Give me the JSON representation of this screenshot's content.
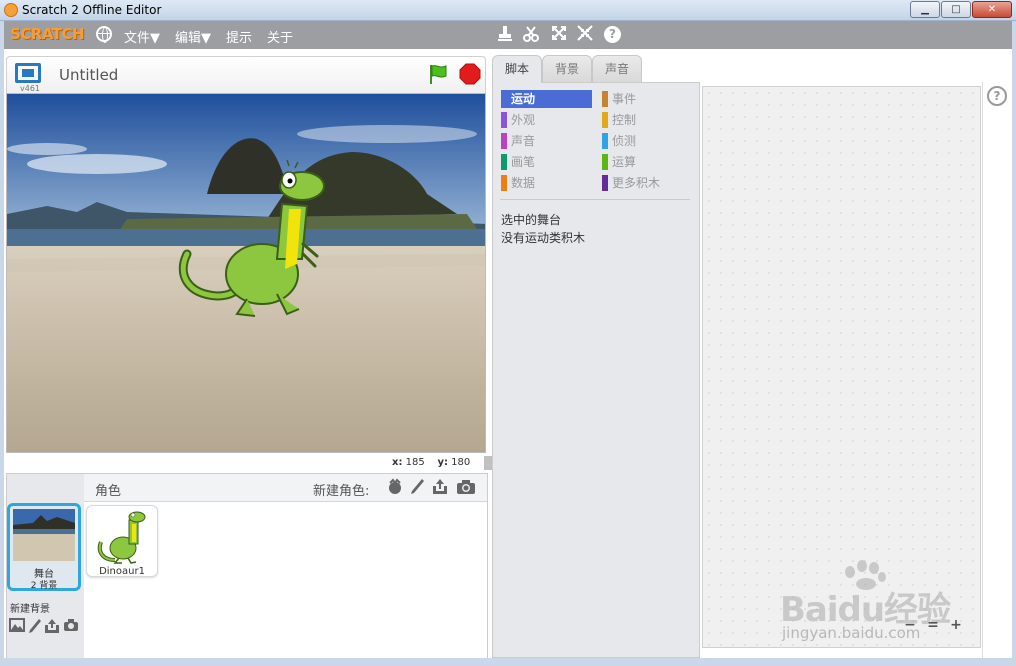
{
  "window": {
    "title": "Scratch 2 Offline Editor",
    "min_label": "▁",
    "max_label": "□",
    "close_label": "✕"
  },
  "menubar": {
    "logo": "SCRATCH",
    "items": [
      {
        "label": "文件▼"
      },
      {
        "label": "编辑▼"
      },
      {
        "label": "提示"
      },
      {
        "label": "关于"
      }
    ],
    "help": "?"
  },
  "stage_header": {
    "version": "v461",
    "project_title": "Untitled"
  },
  "stage": {
    "coords": {
      "x_label": "x:",
      "x_value": "185",
      "y_label": "y:",
      "y_value": "180"
    }
  },
  "sprite_pane": {
    "title": "角色",
    "new_sprite_label": "新建角色:",
    "stage_thumb": {
      "label": "舞台",
      "backdrops": "2 背景"
    },
    "new_backdrop_label": "新建背景",
    "sprites": [
      {
        "name": "Dinoaur1"
      }
    ]
  },
  "tabs": [
    {
      "label": "脚本"
    },
    {
      "label": "背景"
    },
    {
      "label": "声音"
    }
  ],
  "palette": {
    "categories_left": [
      {
        "label": "运动",
        "color": "#4a6cd4"
      },
      {
        "label": "外观",
        "color": "#8a55d7"
      },
      {
        "label": "声音",
        "color": "#bb42c3"
      },
      {
        "label": "画笔",
        "color": "#0e9a6c"
      },
      {
        "label": "数据",
        "color": "#ee7d16"
      }
    ],
    "categories_right": [
      {
        "label": "事件",
        "color": "#c88330"
      },
      {
        "label": "控制",
        "color": "#e1a91a"
      },
      {
        "label": "侦测",
        "color": "#2ca5e2"
      },
      {
        "label": "运算",
        "color": "#5cb712"
      },
      {
        "label": "更多积木",
        "color": "#632d99"
      }
    ],
    "message_line1": "选中的舞台",
    "message_line2": "没有运动类积木"
  },
  "scripts_area": {
    "help": "?",
    "zoom_out": "−",
    "zoom_reset": "=",
    "zoom_in": "+"
  },
  "watermark": {
    "text": "Baidu经验",
    "sub": "jingyan.baidu.com"
  }
}
